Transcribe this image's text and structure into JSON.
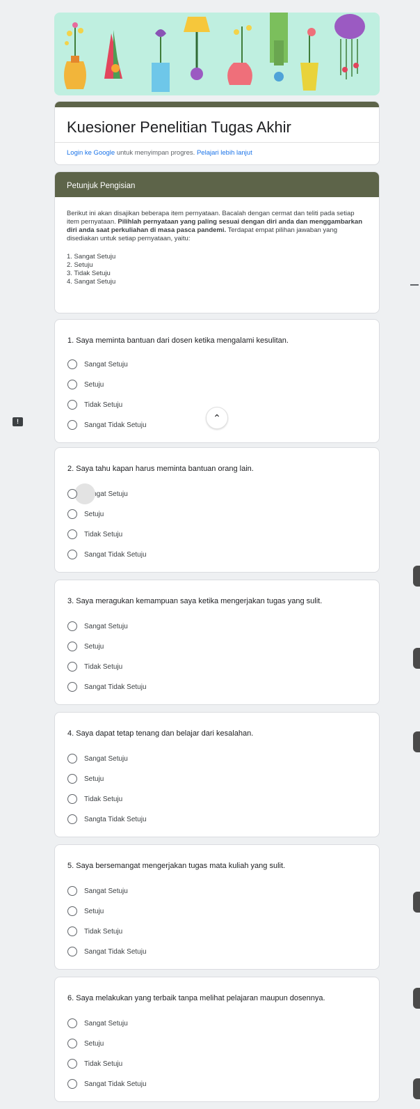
{
  "form": {
    "title": "Kuesioner Penelitian Tugas Akhir",
    "login_link": "Login ke Google",
    "login_text": " untuk menyimpan progres. ",
    "learn_more": "Pelajari lebih lanjut"
  },
  "section": {
    "header": "Petunjuk Pengisian",
    "intro_1": "Berikut ini akan disajikan beberapa item pernyataan. Bacalah dengan cermat dan teliti pada setiap item pernyataan. ",
    "intro_bold": "Pilihlah pernyataan yang paling sesuai dengan diri anda dan menggambarkan diri anda saat perkuliahan di masa pasca pandemi.",
    "intro_2": " Terdapat empat pilihan jawaban yang disediakan untuk setiap pernyataan, yaitu:",
    "choices": [
      "1. Sangat Setuju",
      "2. Setuju",
      "3. Tidak Setuju",
      "4. Sangat Setuju"
    ]
  },
  "questions": [
    {
      "text": "1. Saya meminta bantuan dari dosen ketika mengalami kesulitan.",
      "options": [
        "Sangat Setuju",
        "Setuju",
        "Tidak Setuju",
        "Sangat Tidak Setuju"
      ]
    },
    {
      "text": "2. Saya tahu kapan harus meminta bantuan orang lain.",
      "options": [
        "Sangat Setuju",
        "Setuju",
        "Tidak Setuju",
        "Sangat Tidak Setuju"
      ]
    },
    {
      "text": "3. Saya meragukan kemampuan saya ketika mengerjakan tugas yang sulit.",
      "options": [
        "Sangat Setuju",
        "Setuju",
        "Tidak Setuju",
        "Sangat Tidak Setuju"
      ]
    },
    {
      "text": "4. Saya dapat tetap tenang dan belajar dari kesalahan.",
      "options": [
        "Sangat Setuju",
        "Setuju",
        "Tidak Setuju",
        "Sangta Tidak Setuju"
      ]
    },
    {
      "text": "5. Saya bersemangat mengerjakan tugas mata kuliah yang sulit.",
      "options": [
        "Sangat Setuju",
        "Setuju",
        "Tidak Setuju",
        "Sangat Tidak Setuju"
      ]
    },
    {
      "text": "6. Saya melakukan yang terbaik tanpa melihat pelajaran maupun dosennya.",
      "options": [
        "Sangat Setuju",
        "Setuju",
        "Tidak Setuju",
        "Sangat Tidak Setuju"
      ]
    }
  ],
  "icons": {
    "scroll_up": "chevron-up-icon",
    "report": "report-icon"
  },
  "colors": {
    "accent": "#5d6449",
    "link": "#1a73e8",
    "background": "#eef0f2",
    "banner": "#bfefe0"
  }
}
